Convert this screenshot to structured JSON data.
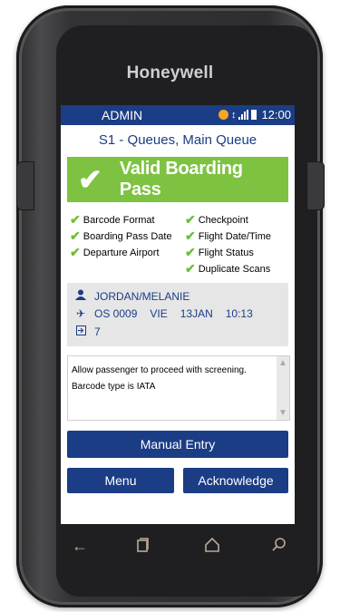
{
  "device": {
    "brand": "Honeywell"
  },
  "statusbar": {
    "user": "ADMIN",
    "time": "12:00"
  },
  "queue_title": "S1 - Queues, Main Queue",
  "banner": {
    "text": "Valid Boarding Pass",
    "color": "#7ec242"
  },
  "checks_left": [
    "Barcode Format",
    "Boarding Pass Date",
    "Departure Airport"
  ],
  "checks_right": [
    "Checkpoint",
    "Flight Date/Time",
    "Flight Status",
    "Duplicate Scans"
  ],
  "passenger": {
    "name": "JORDAN/MELANIE",
    "flight": "OS 0009",
    "from": "VIE",
    "date": "13JAN",
    "time": "10:13",
    "seq": "7"
  },
  "message": {
    "line1": "Allow passenger to proceed with screening.",
    "line2": "Barcode type is IATA"
  },
  "buttons": {
    "manual": "Manual Entry",
    "menu": "Menu",
    "acknowledge": "Acknowledge"
  },
  "colors": {
    "accent": "#1b3d85",
    "check": "#6fbe35",
    "panel": "#e6e6e6"
  }
}
